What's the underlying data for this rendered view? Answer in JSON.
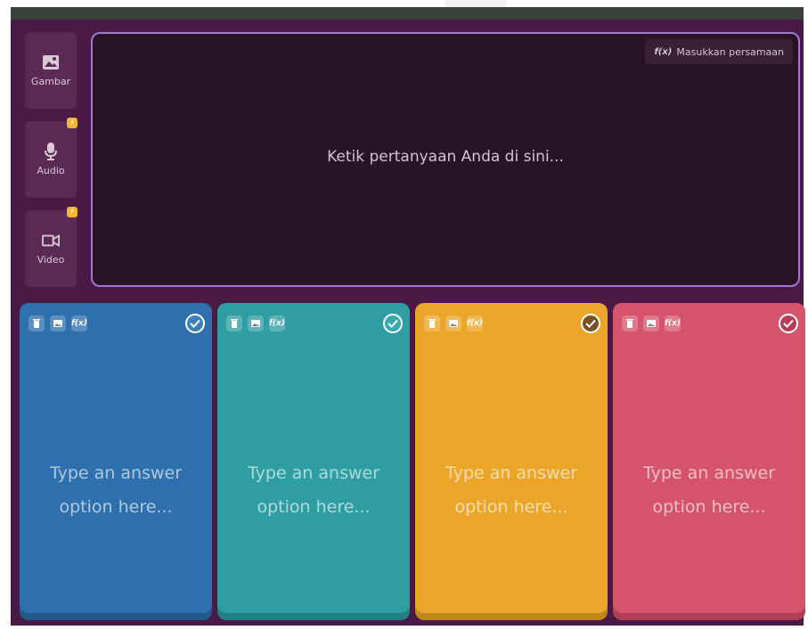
{
  "sidebar": {
    "items": [
      {
        "label": "Gambar",
        "icon": "image-icon",
        "premium": false
      },
      {
        "label": "Audio",
        "icon": "microphone-icon",
        "premium": true
      },
      {
        "label": "Video",
        "icon": "video-icon",
        "premium": true
      }
    ],
    "premium_badge": "⚡"
  },
  "question": {
    "placeholder": "Ketik pertanyaan Anda di sini...",
    "equation_button_icon": "f(x)",
    "equation_button_label": "Masukkan persamaan"
  },
  "answer_tools": {
    "delete_icon": "trash-icon",
    "image_icon": "image-icon",
    "equation_icon": "f(x)"
  },
  "answers": [
    {
      "line1": "Type an answer",
      "line2": "option here...",
      "color": "#2e70ad",
      "shadow": "#235a8c",
      "check_color": "#3c7fb9"
    },
    {
      "line1": "Type an answer",
      "line2": "option here...",
      "color": "#2e9ea3",
      "shadow": "#237f84",
      "check_color": "#3aa9ad"
    },
    {
      "line1": "Type an answer",
      "line2": "option here...",
      "color": "#eba62a",
      "shadow": "#c1861d",
      "check_color": "#7a5220"
    },
    {
      "line1": "Type an answer",
      "line2": "option here...",
      "color": "#d6546b",
      "shadow": "#b13e53",
      "check_color": "#b63d55"
    }
  ]
}
